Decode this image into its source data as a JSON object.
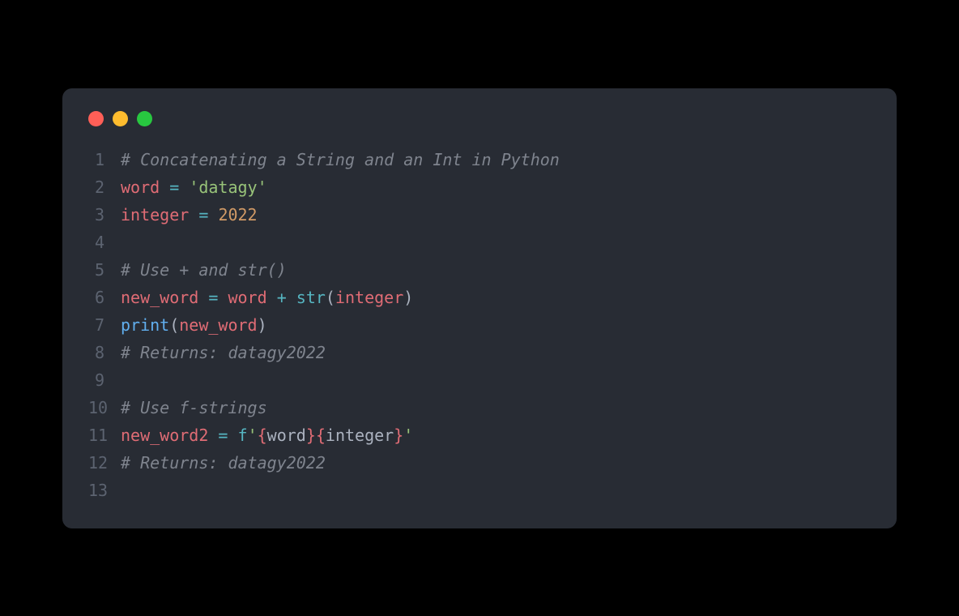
{
  "traffic_lights": {
    "red": "#ff5f57",
    "yellow": "#febc2e",
    "green": "#28c840"
  },
  "lines": {
    "n1": "1",
    "n2": "2",
    "n3": "3",
    "n4": "4",
    "n5": "5",
    "n6": "6",
    "n7": "7",
    "n8": "8",
    "n9": "9",
    "n10": "10",
    "n11": "11",
    "n12": "12",
    "n13": "13"
  },
  "code": {
    "l1_comment": "# Concatenating a String and an Int in Python",
    "l2_var": "word",
    "l2_sp1": " ",
    "l2_op": "=",
    "l2_sp2": " ",
    "l2_str": "'datagy'",
    "l3_var": "integer",
    "l3_sp1": " ",
    "l3_op": "=",
    "l3_sp2": " ",
    "l3_num": "2022",
    "l5_comment": "# Use + and str()",
    "l6_var1": "new_word",
    "l6_sp1": " ",
    "l6_op1": "=",
    "l6_sp2": " ",
    "l6_var2": "word",
    "l6_sp3": " ",
    "l6_op2": "+",
    "l6_sp4": " ",
    "l6_builtin": "str",
    "l6_paren1": "(",
    "l6_var3": "integer",
    "l6_paren2": ")",
    "l7_func": "print",
    "l7_paren1": "(",
    "l7_var": "new_word",
    "l7_paren2": ")",
    "l8_comment": "# Returns: datagy2022",
    "l10_comment": "# Use f-strings",
    "l11_var": "new_word2",
    "l11_sp1": " ",
    "l11_op": "=",
    "l11_sp2": " ",
    "l11_fprefix": "f",
    "l11_q1": "'",
    "l11_brace1": "{",
    "l11_fvar1": "word",
    "l11_brace2": "}",
    "l11_brace3": "{",
    "l11_fvar2": "integer",
    "l11_brace4": "}",
    "l11_q2": "'",
    "l12_comment": "# Returns: datagy2022"
  }
}
